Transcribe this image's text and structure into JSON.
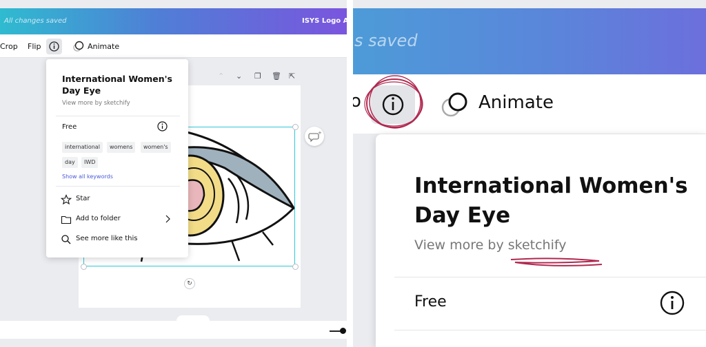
{
  "header": {
    "saved_status": "All changes saved",
    "doc_title": "ISYS Logo Ass"
  },
  "toolbar": {
    "crop_label": "Crop",
    "flip_label": "Flip",
    "animate_label": "Animate"
  },
  "info_popup": {
    "title": "International Women's Day Eye",
    "subtitle": "View more by sketchify",
    "price": "Free",
    "keywords": [
      "international",
      "womens",
      "women's",
      "day",
      "IWD"
    ],
    "show_all_keywords": "Show all keywords",
    "actions": {
      "star": "Star",
      "add_to_folder": "Add to folder",
      "see_more": "See more like this"
    }
  },
  "zoom": {
    "saved_status": "s saved",
    "animate_label": "Animate",
    "title": "International Women's Day Eye",
    "subtitle": "View more by sketchify",
    "price": "Free"
  },
  "colors": {
    "header_gradient_start": "#2fbbd0",
    "header_gradient_end": "#7a55de",
    "selection": "#2ec7d6",
    "link": "#4b5ad8",
    "annotation": "#b0284f"
  }
}
